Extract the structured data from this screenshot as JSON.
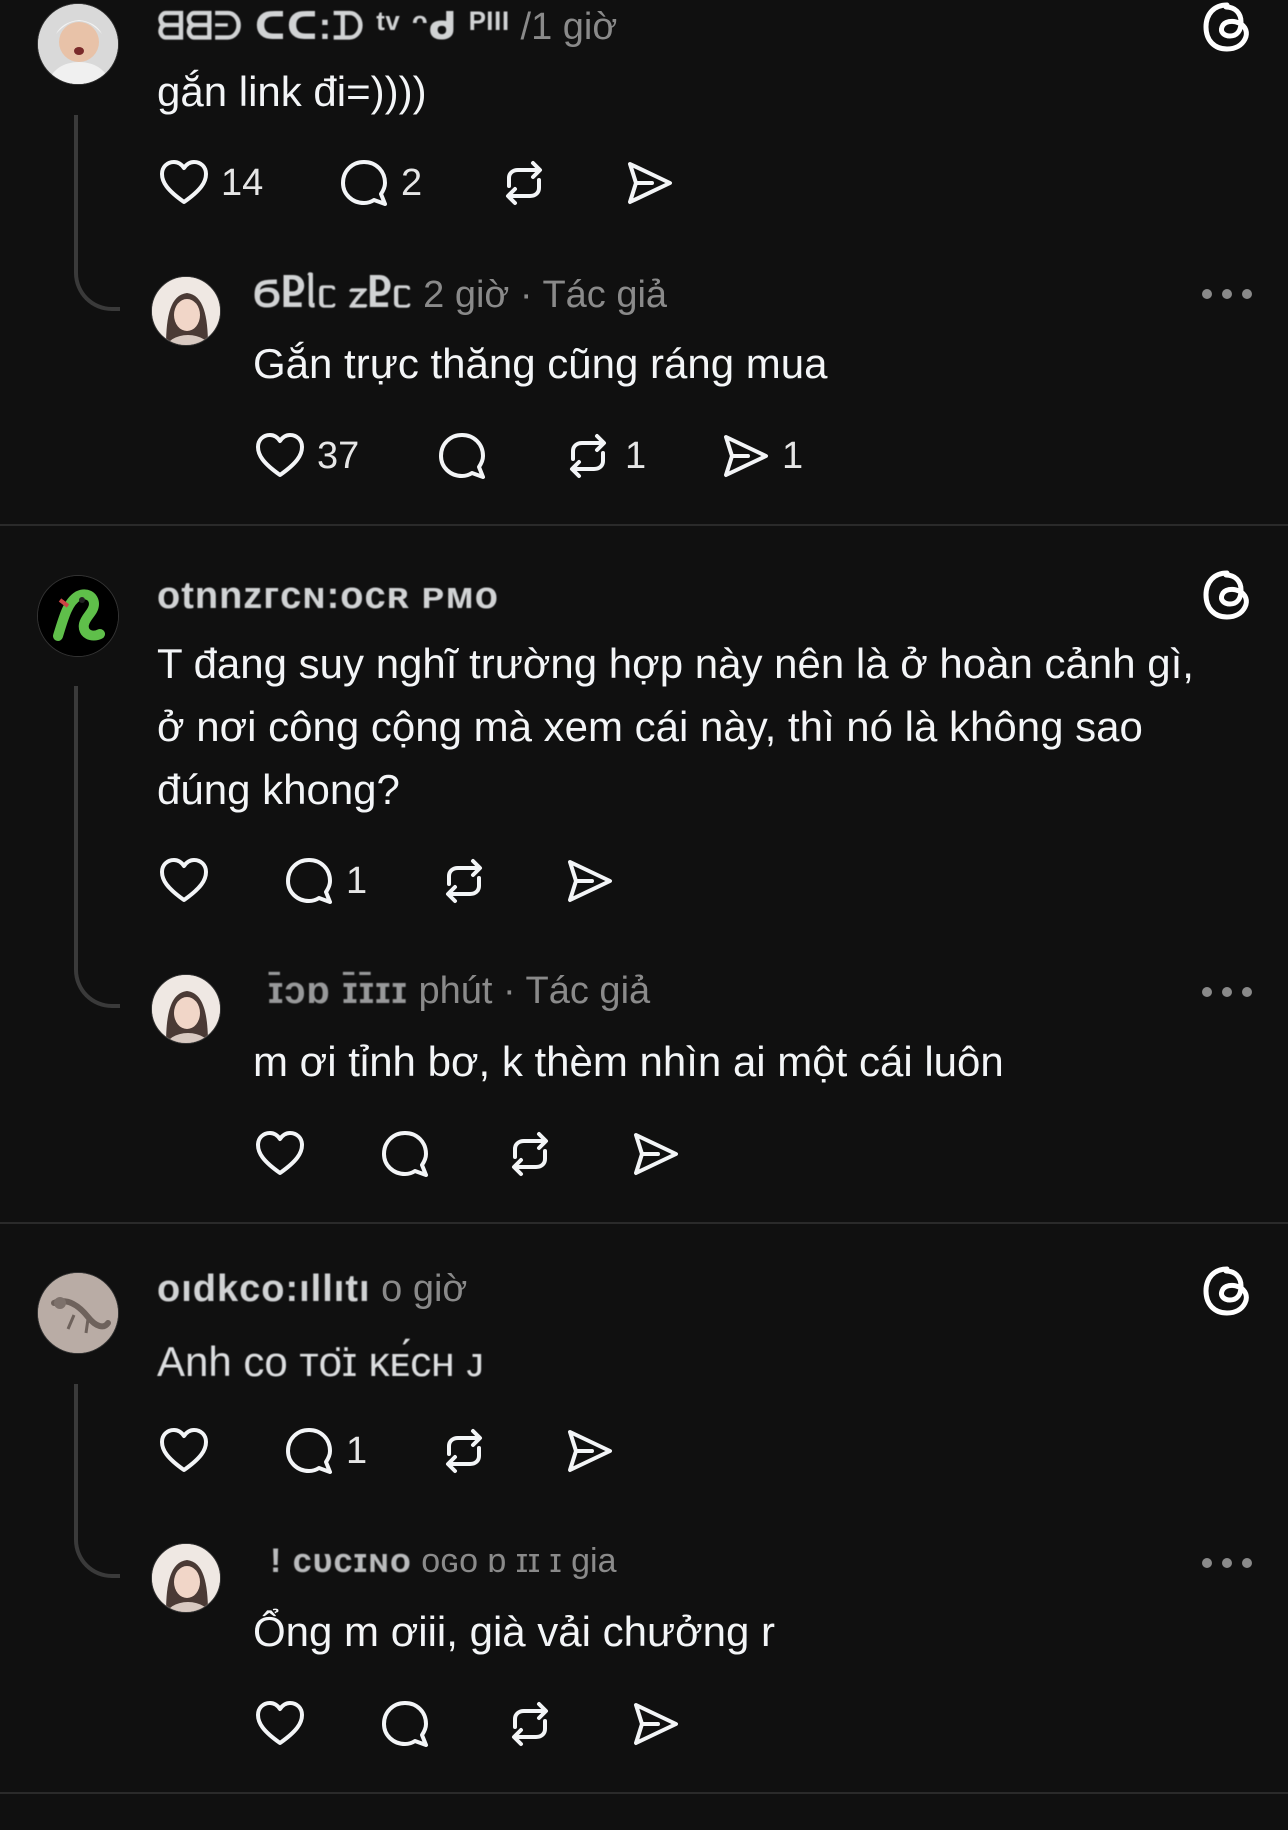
{
  "threads": [
    {
      "comment": {
        "username": "ᗺᗺᕭ ᑕᑕ:ᗪ ᵗᵛ ᵔᑯ ᴾᴵᴵᴵ",
        "time": "/1 giờ",
        "text": "gắn link đi=))))",
        "likes": "14",
        "replies": "2",
        "reposts": "",
        "shares": ""
      },
      "reply": {
        "username": "ϬႲᥣᥴ ᤁႲᥴ",
        "time": "2 giờ",
        "author_tag": "Tác giả",
        "text": "Gắn trực thăng cũng ráng mua",
        "likes": "37",
        "replies": "",
        "reposts": "1",
        "shares": "1"
      }
    },
    {
      "comment": {
        "username": "otnnᴢᴦᴄɴ:ᴏᴄʀ ᴘᴍᴏ",
        "time": "",
        "text": "T đang suy nghĩ trường hợp này nên là ở hoàn cảnh gì, ở nơi công cộng mà xem cái này, thì nó là không sao đúng khong?",
        "likes": "",
        "replies": "1",
        "reposts": "",
        "shares": ""
      },
      "reply": {
        "username": "ɪ̄ɔɒ ɪ̄ɪ̄ɪɪ",
        "time": "phút",
        "author_tag": "Tác giả",
        "text": "m ơi tỉnh bơ, k thèm nhìn ai một cái luôn",
        "likes": "",
        "replies": "",
        "reposts": "",
        "shares": ""
      }
    },
    {
      "comment": {
        "username": "oıdkco:ıllıtı",
        "time": "o giờ",
        "text": "Anh co ᴛᴏ̈ɪ ᴋᴇ́ᴄʜ ᴊ",
        "likes": "",
        "replies": "1",
        "reposts": "",
        "shares": ""
      },
      "reply": {
        "username": "! ᴄᴜᴄɪɴᴏ",
        "time": "ᴏɢᴏ ɒ ɪɪ ɪ",
        "author_tag": "gia",
        "text": "Ổng m ơiii, già vải chưởng r",
        "likes": "",
        "replies": "",
        "reposts": "",
        "shares": ""
      }
    }
  ],
  "icons": {
    "like": "heart-icon",
    "reply": "comment-icon",
    "repost": "repost-icon",
    "share": "share-icon",
    "logo": "threads-logo-icon",
    "more": "more-icon"
  },
  "colors": {
    "background": "#101010",
    "text": "#f3f5f7",
    "secondary": "#8a8a8a",
    "divider": "#2a2a2a"
  }
}
